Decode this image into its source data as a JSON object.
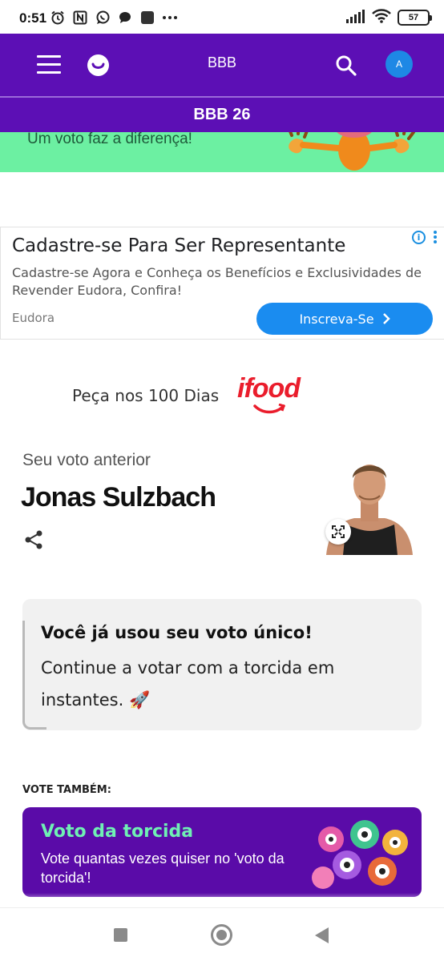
{
  "status_bar": {
    "time": "0:51",
    "battery": "57",
    "icons_left": [
      "alarm-icon",
      "nfc-icon",
      "whatsapp-icon",
      "chat-icon",
      "app-icon",
      "more-dots-icon"
    ],
    "icons_right": [
      "signal-icon",
      "wifi-icon",
      "battery-icon"
    ]
  },
  "header": {
    "title": "BBB",
    "avatar_initial": "A",
    "section_title": "BBB 26"
  },
  "banner": {
    "text": "Um voto faz a diferença!"
  },
  "ad": {
    "title": "Cadastre-se Para Ser Representante",
    "body": "Cadastre-se Agora e Conheça os Benefícios e Exclusividades de Revender Eudora, Confira!",
    "source": "Eudora",
    "cta": "Inscreva-Se",
    "info_glyph": "i"
  },
  "promo": {
    "text": "Peça nos 100 Dias",
    "brand": "ifood"
  },
  "previous_vote": {
    "label": "Seu voto anterior",
    "name": "Jonas Sulzbach"
  },
  "info_box": {
    "title": "Você já usou seu voto único!",
    "body": "Continue a votar com a torcida em instantes. 🚀"
  },
  "vote_also": {
    "label": "VOTE TAMBÉM:",
    "card_title": "Voto da torcida",
    "card_body": "Vote quantas vezes quiser no 'voto da torcida'!"
  },
  "colors": {
    "brand_purple": "#5c0fb5",
    "banner_green": "#6cf0a2",
    "cta_blue": "#1a8cf0",
    "ifood_red": "#ea1d2c",
    "torcida_green": "#6ff0b4"
  }
}
